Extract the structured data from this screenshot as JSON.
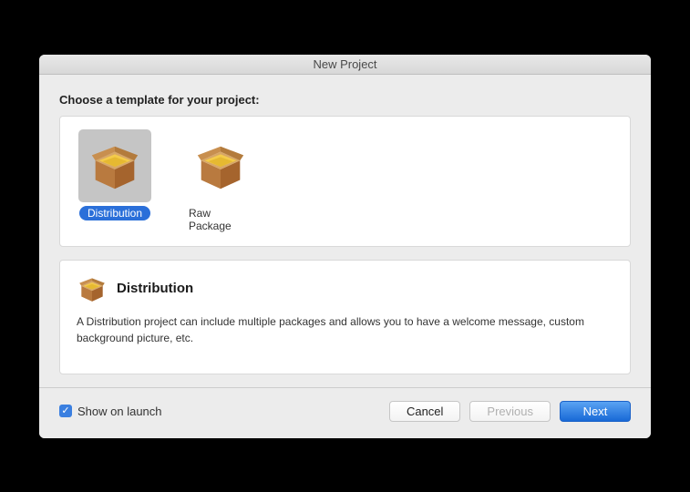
{
  "window": {
    "title": "New Project"
  },
  "heading": "Choose a template for your project:",
  "templates": [
    {
      "label": "Distribution",
      "selected": true
    },
    {
      "label": "Raw Package",
      "selected": false
    }
  ],
  "description": {
    "title": "Distribution",
    "text": "A Distribution project can include multiple packages and allows you to have a welcome message, custom background picture, etc."
  },
  "footer": {
    "show_on_launch_label": "Show on launch",
    "show_on_launch_checked": true,
    "cancel": "Cancel",
    "previous": "Previous",
    "next": "Next"
  }
}
